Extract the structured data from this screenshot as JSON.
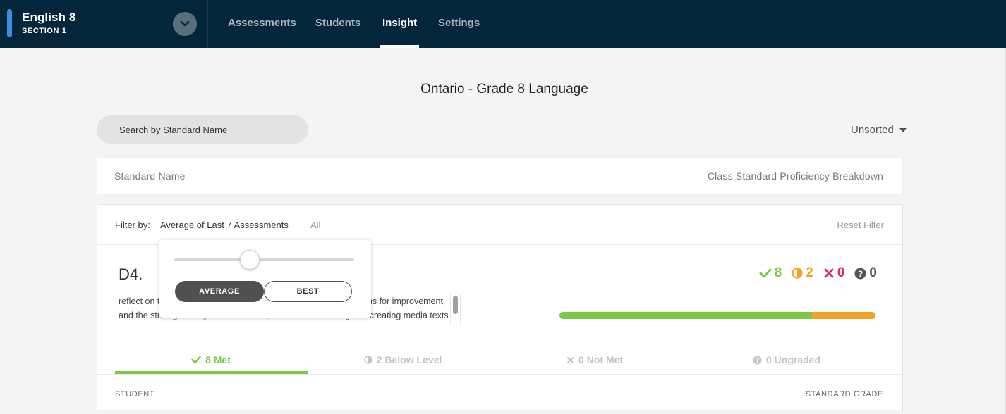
{
  "header": {
    "course_title": "English 8",
    "course_section": "SECTION 1",
    "nav": [
      {
        "label": "Assessments"
      },
      {
        "label": "Students"
      },
      {
        "label": "Insight",
        "active": true
      },
      {
        "label": "Settings"
      }
    ]
  },
  "page": {
    "title": "Ontario - Grade 8 Language"
  },
  "search": {
    "placeholder": "Search by Standard Name",
    "value": ""
  },
  "sort": {
    "selected": "Unsorted"
  },
  "columns": {
    "left": "Standard Name",
    "right": "Class Standard Proficiency Breakdown"
  },
  "filter": {
    "label": "Filter by:",
    "selected": "Average of Last 7 Assessments",
    "all": "All",
    "reset": "Reset Filter",
    "popover": {
      "slider_fraction": 0.42,
      "options": [
        "AVERAGE",
        "BEST"
      ],
      "selected_option": "AVERAGE"
    }
  },
  "standard": {
    "code": "D4.",
    "description": "reflect on their strengths as media interpreters and creators, areas for improvement, and the strategies they found most helpful in understanding and creating media texts",
    "counts": {
      "met": "8",
      "below": "2",
      "not_met": "0",
      "ungraded": "0"
    },
    "breakdown": {
      "met": 8,
      "below": 2,
      "not_met": 0,
      "ungraded": 0
    },
    "tabs": [
      {
        "label": "8 Met",
        "icon": "check-icon",
        "active": true
      },
      {
        "label": "2 Below Level",
        "icon": "half-circle-icon"
      },
      {
        "label": "0 Not Met",
        "icon": "x-icon"
      },
      {
        "label": "0 Ungraded",
        "icon": "question-icon"
      }
    ],
    "table_headers": {
      "student": "STUDENT",
      "grade": "STANDARD GRADE"
    }
  },
  "colors": {
    "topbar": "#03263a",
    "accent": "#3b8de0",
    "met": "#7ac943",
    "below": "#f3a221",
    "not_met": "#e02477",
    "ungraded": "#555555"
  }
}
